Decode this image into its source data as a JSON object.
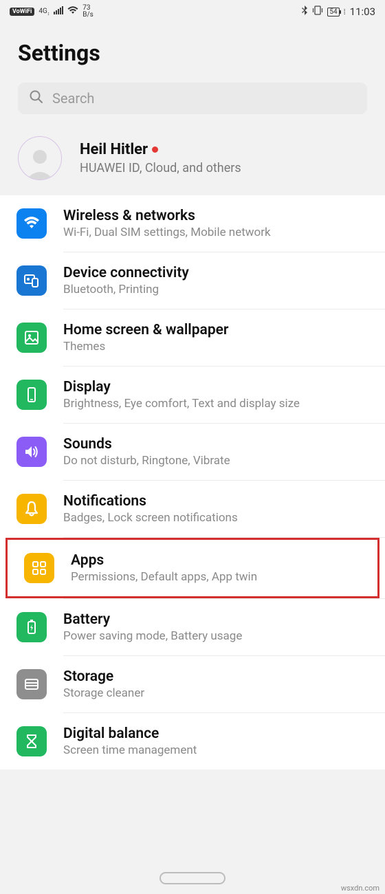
{
  "status": {
    "vowifi": "VoWiFi",
    "signal_label": "4G",
    "speed_num": "73",
    "speed_unit": "B/s",
    "battery": "54",
    "time": "11:03"
  },
  "header": {
    "title": "Settings"
  },
  "search": {
    "placeholder": "Search"
  },
  "account": {
    "name": "Heil Hitler",
    "subtitle": "HUAWEI ID, Cloud, and others"
  },
  "items": [
    {
      "icon": "wifi-icon",
      "bg": "bg-blue1",
      "title": "Wireless & networks",
      "sub": "Wi-Fi, Dual SIM settings, Mobile network"
    },
    {
      "icon": "device-connectivity-icon",
      "bg": "bg-blue2",
      "title": "Device connectivity",
      "sub": "Bluetooth, Printing"
    },
    {
      "icon": "wallpaper-icon",
      "bg": "bg-green",
      "title": "Home screen & wallpaper",
      "sub": "Themes"
    },
    {
      "icon": "display-icon",
      "bg": "bg-green",
      "title": "Display",
      "sub": "Brightness, Eye comfort, Text and display size"
    },
    {
      "icon": "sounds-icon",
      "bg": "bg-purple",
      "title": "Sounds",
      "sub": "Do not disturb, Ringtone, Vibrate"
    },
    {
      "icon": "notifications-icon",
      "bg": "bg-yellow",
      "title": "Notifications",
      "sub": "Badges, Lock screen notifications"
    },
    {
      "icon": "apps-icon",
      "bg": "bg-yellow",
      "title": "Apps",
      "sub": "Permissions, Default apps, App twin",
      "highlighted": true
    },
    {
      "icon": "battery-icon",
      "bg": "bg-green",
      "title": "Battery",
      "sub": "Power saving mode, Battery usage"
    },
    {
      "icon": "storage-icon",
      "bg": "bg-gray",
      "title": "Storage",
      "sub": "Storage cleaner"
    },
    {
      "icon": "digital-balance-icon",
      "bg": "bg-green",
      "title": "Digital balance",
      "sub": "Screen time management"
    }
  ],
  "watermark": "wsxdn.com"
}
